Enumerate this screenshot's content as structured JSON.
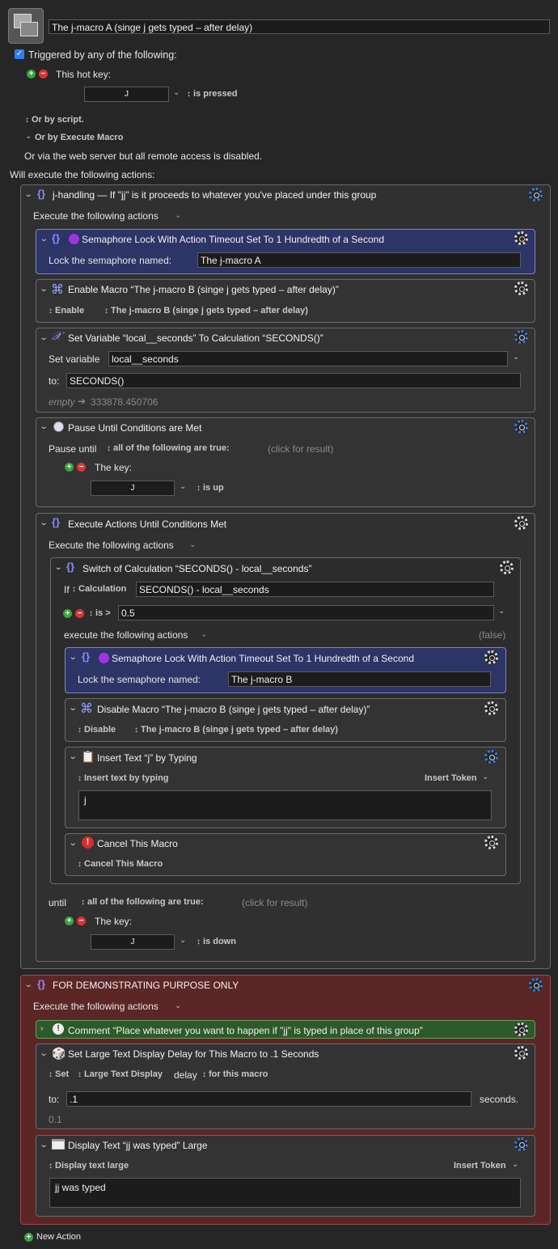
{
  "macro": {
    "name": "The j-macro A (singe j gets typed – after delay)"
  },
  "triggers": {
    "enabled_label": "Triggered by any of the following:",
    "hotkey_label": "This hot key:",
    "hotkey_value": "J",
    "hotkey_state": "is pressed",
    "or_script": "Or by script.",
    "or_execute": "Or by Execute Macro",
    "web_server": "Or via the web server but all remote access is disabled.",
    "will_execute": "Will execute the following actions:"
  },
  "g1": {
    "title": "j-handling — If \"jj\" is it proceeds to whatever you've placed under this group",
    "exec": "Execute the following actions"
  },
  "a1": {
    "title": "Semaphore Lock With Action Timeout Set To 1 Hundredth of a Second",
    "label": "Lock the semaphore named:",
    "value": "The j-macro A"
  },
  "a2": {
    "title": "Enable Macro “The j-macro B (singe j gets typed – after delay)”",
    "opt1": "Enable",
    "opt2": "The j-macro B (singe j gets typed – after delay)"
  },
  "a3": {
    "title": "Set Variable “local__seconds” To Calculation “SECONDS()”",
    "set_label": "Set variable",
    "set_value": "local__seconds",
    "to_label": "to:",
    "to_value": "SECONDS()",
    "result_empty": "empty",
    "result_value": "333878.450706"
  },
  "a4": {
    "title": "Pause Until Conditions are Met",
    "pause_label": "Pause until",
    "cond": "all of the following are true:",
    "click": "(click for result)",
    "key_label": "The key:",
    "key_value": "J",
    "key_state": "is up"
  },
  "a5": {
    "title": "Execute Actions Until Conditions Met",
    "exec": "Execute the following actions",
    "until_label": "until",
    "cond": "all of the following are true:",
    "click": "(click for result)",
    "key_label": "The key:",
    "key_value": "J",
    "key_state": "is down"
  },
  "sw": {
    "title": "Switch of Calculation “SECONDS() - local__seconds”",
    "if_label": "If",
    "calc": "Calculation",
    "calc_value": "SECONDS() - local__seconds",
    "cmp": "is >",
    "cmp_value": "0.5",
    "exec": "execute the following actions",
    "false": "(false)"
  },
  "b1": {
    "title": "Semaphore Lock With Action Timeout Set To 1 Hundredth of a Second",
    "label": "Lock the semaphore named:",
    "value": "The j-macro B"
  },
  "b2": {
    "title": "Disable Macro “The j-macro B (singe j gets typed – after delay)”",
    "opt1": "Disable",
    "opt2": "The j-macro B (singe j gets typed – after delay)"
  },
  "b3": {
    "title": "Insert Text “j” by Typing",
    "opt": "Insert text by typing",
    "token": "Insert Token",
    "text": "j"
  },
  "b4": {
    "title": "Cancel This Macro",
    "opt": "Cancel This Macro"
  },
  "g2": {
    "title": "FOR DEMONSTRATING PURPOSE ONLY",
    "exec": "Execute the following actions"
  },
  "c1": {
    "title": "Comment “Place whatever you want to happen if \"jj\" is typed in place of this group”"
  },
  "c2": {
    "title": "Set Large Text Display Delay for This Macro to .1 Seconds",
    "set": "Set",
    "ltd": "Large Text Display",
    "delay": "delay",
    "for": "for this macro",
    "to_label": "to:",
    "to_value": ".1",
    "seconds": "seconds.",
    "result": "0.1"
  },
  "c3": {
    "title": "Display Text “jj was typed” Large",
    "opt": "Display text large",
    "token": "Insert Token",
    "text": "jj was typed"
  },
  "footer": {
    "new_action": "New Action"
  },
  "colors": {
    "group_red": "#5c2626",
    "semaphore_blue": "#2d3466",
    "comment_green": "#2d5a2a",
    "checkbox": "#2f7cf6"
  }
}
